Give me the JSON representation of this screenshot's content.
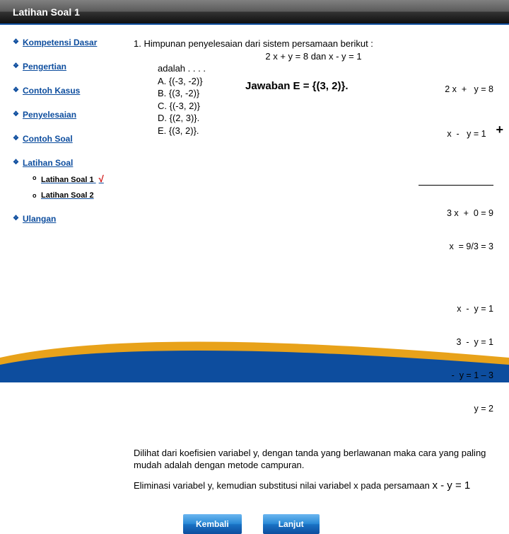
{
  "header": {
    "title": "Latihan Soal 1"
  },
  "sidebar": {
    "items": [
      {
        "label": "Kompetensi Dasar"
      },
      {
        "label": "Pengertian"
      },
      {
        "label": "Contoh Kasus"
      },
      {
        "label": "Penyelesaian"
      },
      {
        "label": "Contoh Soal"
      },
      {
        "label": "Latihan Soal"
      },
      {
        "label": "Ulangan"
      }
    ],
    "sub": {
      "s1": "Latihan Soal 1",
      "s2": "Latihan Soal 2",
      "check": "√"
    }
  },
  "content": {
    "q_num": "1. ",
    "q_text": "Himpunan penyelesaian dari sistem persamaan berikut :",
    "q_eq": "2 x  +  y = 8  dan  x - y = 1",
    "adl": "adalah . . . .",
    "opts": {
      "a": "A. {(-3, -2)}",
      "b": "B. {(3, -2)}",
      "c": "C. {(-3, 2)}",
      "d": "D. {(2, 3)}.",
      "e": "E. {(3, 2)}."
    },
    "answer": "Jawaban E = {(3, 2)}.",
    "work1": {
      "l1": "2 x  +   y = 8",
      "l2": "x  -   y = 1   ",
      "plus": "+",
      "l3": "3 x  +  0 = 9",
      "l4": "x  = 9/3 = 3"
    },
    "work2": {
      "l1": "x  -  y = 1",
      "l2": "3  -  y = 1",
      "l3": "-  y = 1 – 3",
      "l4": "y = 2"
    },
    "expl1": "Dilihat dari koefisien variabel y, dengan tanda yang berlawanan maka cara yang paling mudah adalah dengan metode campuran.",
    "expl2a": "Eliminasi variabel y, kemudian substitusi nilai variabel x pada persamaan ",
    "expl2b": "x - y = 1"
  },
  "buttons": {
    "back": "Kembali",
    "next": "Lanjut"
  }
}
